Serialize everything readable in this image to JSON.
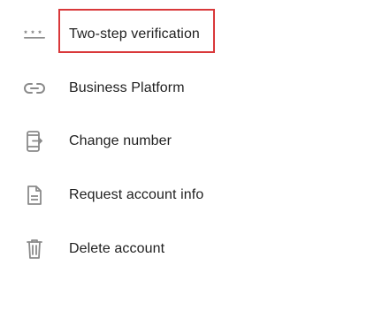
{
  "menu": {
    "items": [
      {
        "label": "Two-step verification",
        "icon": "password-dots-icon"
      },
      {
        "label": "Business Platform",
        "icon": "link-icon"
      },
      {
        "label": "Change number",
        "icon": "phone-change-icon"
      },
      {
        "label": "Request account info",
        "icon": "document-icon"
      },
      {
        "label": "Delete account",
        "icon": "trash-icon"
      }
    ]
  },
  "colors": {
    "icon": "#8a8a8a",
    "text": "#1f1f1f",
    "highlight": "#d9383a"
  }
}
